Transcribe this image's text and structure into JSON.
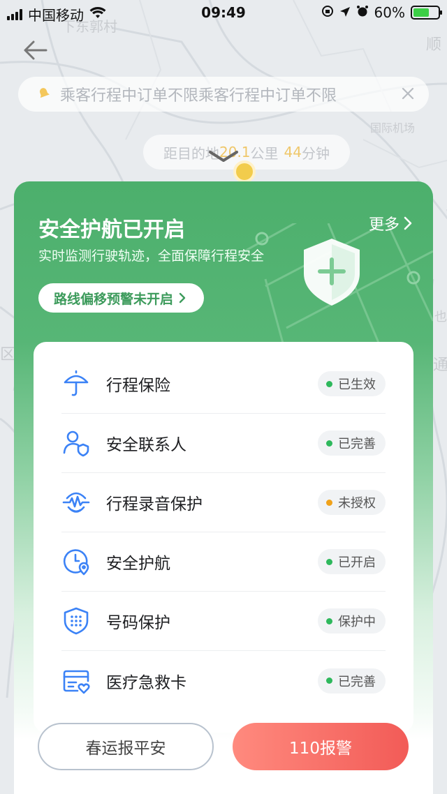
{
  "status_bar": {
    "carrier": "中国移动",
    "time": "09:49",
    "battery": "60%"
  },
  "map": {
    "labels": [
      "下东郭村",
      "顺",
      "国际机场",
      "区",
      "通",
      "也"
    ]
  },
  "notice": {
    "text": "乘客行程中订单不限乘客行程中订单不限",
    "close_icon": "close-icon"
  },
  "distance": {
    "prefix": "距目的地",
    "km": "20.1",
    "km_unit": "公里",
    "minutes": "44",
    "min_unit": "分钟"
  },
  "card": {
    "title": "安全护航已开启",
    "subtitle": "实时监测行驶轨迹，全面保障行程安全",
    "more": "更多",
    "route_alert": "路线偏移预警未开启",
    "items": [
      {
        "label": "行程保险",
        "status": "已生效",
        "dot_color": "#2eb85c",
        "icon": "umbrella-icon"
      },
      {
        "label": "安全联系人",
        "status": "已完善",
        "dot_color": "#2eb85c",
        "icon": "contact-shield-icon"
      },
      {
        "label": "行程录音保护",
        "status": "未授权",
        "dot_color": "#f0a21a",
        "icon": "audio-recording-icon"
      },
      {
        "label": "安全护航",
        "status": "已开启",
        "dot_color": "#2eb85c",
        "icon": "clock-location-icon"
      },
      {
        "label": "号码保护",
        "status": "保护中",
        "dot_color": "#2eb85c",
        "icon": "keypad-shield-icon"
      },
      {
        "label": "医疗急救卡",
        "status": "已完善",
        "dot_color": "#2eb85c",
        "icon": "medical-card-icon"
      }
    ]
  },
  "buttons": {
    "peace": "春运报平安",
    "alarm": "110报警"
  },
  "colors": {
    "accent_green": "#4caf6c",
    "icon_blue": "#3b82f6",
    "alarm_red": "#f25b57"
  }
}
